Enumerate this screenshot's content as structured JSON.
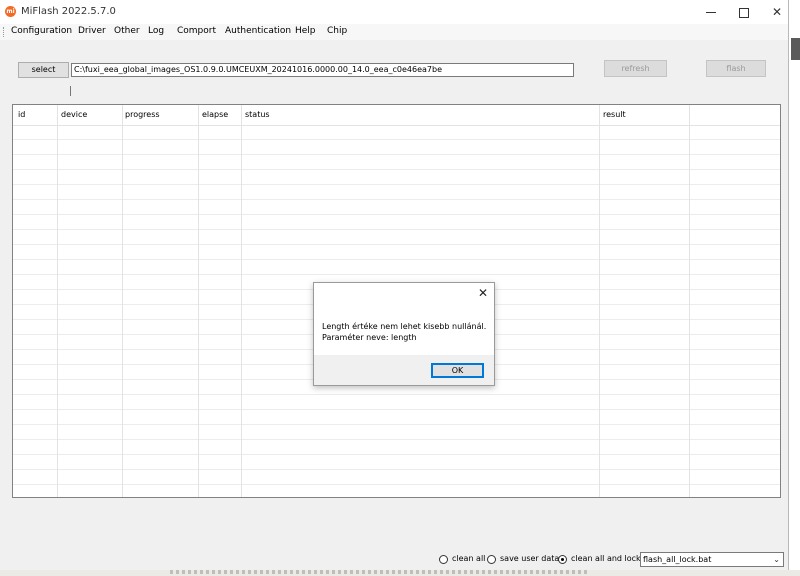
{
  "window": {
    "title": "MiFlash 2022.5.7.0",
    "logo_text": "mi",
    "minimize_icon": "minimize-icon",
    "maximize_icon": "maximize-icon",
    "close_glyph": "✕"
  },
  "menu": {
    "items": [
      "Configuration",
      "Driver",
      "Other",
      "Log",
      "Comport",
      "Authentication",
      "Help",
      "Chip"
    ]
  },
  "toolbar": {
    "select_label": "select",
    "path_value": "C:\\fuxi_eea_global_images_OS1.0.9.0.UMCEUXM_20241016.0000.00_14.0_eea_c0e46ea7be",
    "refresh_label": "refresh",
    "flash_label": "flash"
  },
  "grid": {
    "columns": [
      "id",
      "device",
      "progress",
      "elapse",
      "status",
      "result"
    ],
    "rows": []
  },
  "status_bar": {
    "options": [
      {
        "label": "clean all",
        "checked": false
      },
      {
        "label": "save user data",
        "checked": false
      },
      {
        "label": "clean all and lock",
        "checked": true
      }
    ],
    "script": "flash_all_lock.bat",
    "dropdown_icon": "chevron-down-icon"
  },
  "dialog": {
    "message_line1": "Length értéke nem lehet kisebb nullánál.",
    "message_line2": "Paraméter neve: length",
    "ok_label": "OK",
    "close_glyph": "✕"
  },
  "colors": {
    "logo_orange": "#f26a23",
    "focus_blue": "#0078d7",
    "window_bg": "#f0f0f0"
  }
}
